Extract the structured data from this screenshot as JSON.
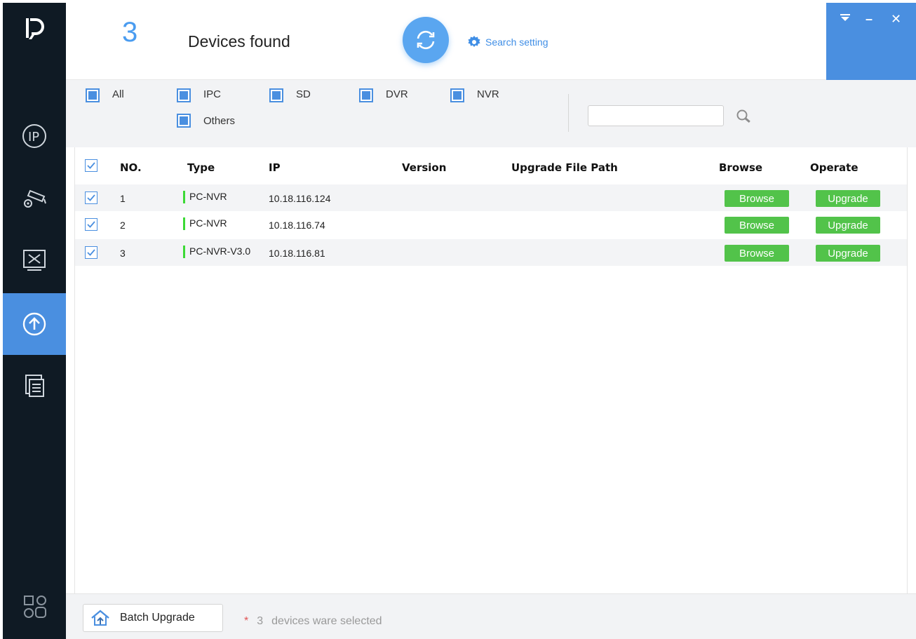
{
  "header": {
    "device_count": "3",
    "devices_found_label": "Devices found",
    "search_setting_label": "Search setting"
  },
  "sidebar": {
    "logo": "D",
    "items": [
      {
        "icon": "ip-icon",
        "active": false
      },
      {
        "icon": "camera-config-icon",
        "active": false
      },
      {
        "icon": "tools-icon",
        "active": false
      },
      {
        "icon": "upgrade-icon",
        "active": true
      },
      {
        "icon": "document-icon",
        "active": false
      },
      {
        "icon": "grid-icon",
        "active": false
      }
    ]
  },
  "window": {
    "buttons": [
      "dropdown-icon",
      "minimize-icon",
      "close-icon"
    ],
    "minimize_glyph": "–",
    "close_glyph": "✕"
  },
  "filters": {
    "all": "All",
    "ipc": "IPC",
    "sd": "SD",
    "dvr": "DVR",
    "nvr": "NVR",
    "others": "Others",
    "search_value": ""
  },
  "table": {
    "columns": {
      "no": "NO.",
      "type": "Type",
      "ip": "IP",
      "version": "Version",
      "path": "Upgrade File Path",
      "browse": "Browse",
      "operate": "Operate"
    },
    "rows": [
      {
        "no": "1",
        "type": "PC-NVR",
        "ip": "10.18.116.124",
        "version": "",
        "path": "",
        "browse": "Browse",
        "operate": "Upgrade"
      },
      {
        "no": "2",
        "type": "PC-NVR",
        "ip": "10.18.116.74",
        "version": "",
        "path": "",
        "browse": "Browse",
        "operate": "Upgrade"
      },
      {
        "no": "3",
        "type": "PC-NVR-V3.0",
        "ip": "10.18.116.81",
        "version": "",
        "path": "",
        "browse": "Browse",
        "operate": "Upgrade"
      }
    ]
  },
  "footer": {
    "batch_upgrade_label": "Batch Upgrade",
    "star": "*",
    "selected_count": "3",
    "selected_text": "devices ware selected"
  },
  "colors": {
    "accent": "#4a8fe0",
    "sidebar_bg": "#0f1a24",
    "green_button": "#52c34a",
    "type_indicator": "#3cd936"
  }
}
